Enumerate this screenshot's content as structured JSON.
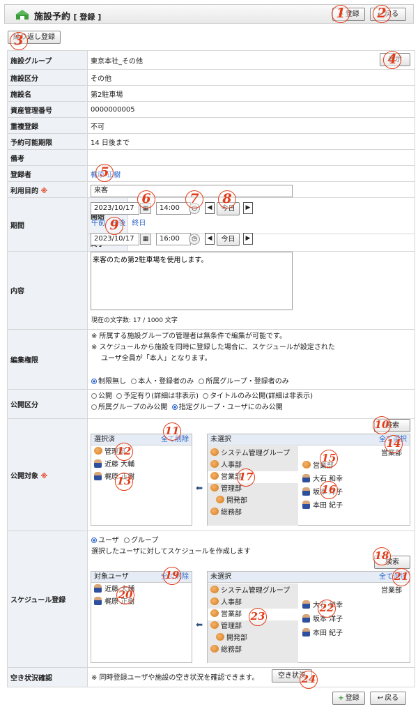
{
  "header": {
    "title": "施設予約",
    "mode": "[ 登録 ]",
    "register": "登録",
    "back": "戻る"
  },
  "repeat_button": "繰り返し登録",
  "facility": {
    "rows": [
      {
        "label": "施設グループ",
        "value": "東京本社_その他"
      },
      {
        "label": "施設区分",
        "value": "その他"
      },
      {
        "label": "施設名",
        "value": "第2駐車場"
      },
      {
        "label": "資産管理番号",
        "value": "0000000005"
      },
      {
        "label": "重複登録",
        "value": "不可"
      },
      {
        "label": "予約可能期限",
        "value": "14 日後まで"
      },
      {
        "label": "備考",
        "value": ""
      }
    ],
    "display_button": "表示"
  },
  "form": {
    "registrant_label": "登録者",
    "registrant": "梶原 正樹",
    "purpose_label": "利用目的",
    "required_mark": "※",
    "purpose": "来客",
    "period_label": "期間",
    "start_label": "開始",
    "end_label": "終了",
    "start_date": "2023/10/17",
    "start_time": "14:00",
    "end_date": "2023/10/17",
    "end_time": "16:00",
    "today": "今日",
    "am": "午前",
    "pm": "午後",
    "allday": "終日",
    "content_label": "内容",
    "content": "来客のため第2駐車場を使用します。",
    "char_count": "現在の文字数: 17 / 1000 文字",
    "edit_label": "編集権限",
    "edit_note1": "※ 所属する施設グループの管理者は無条件で編集が可能です。",
    "edit_note2": "※ スケジュールから施設を同時に登録した場合に、スケジュールが設定された",
    "edit_note3": "ユーザ全員が「本人」となります。",
    "edit_opts": [
      "制限無し",
      "本人・登録者のみ",
      "所属グループ・登録者のみ"
    ],
    "public_label": "公開区分",
    "public_opts": [
      "公開",
      "予定有り(詳細は非表示)",
      "タイトルのみ公開(詳細は非表示)",
      "所属グループのみ公開",
      "指定グループ・ユーザにのみ公開"
    ],
    "target_label": "公開対象",
    "search": "検索",
    "selected": "選択済",
    "clear_all": "全て削除",
    "unselected": "未選択",
    "select_all": "全て選択",
    "selected_items": [
      "管理部",
      "近藤 大輔",
      "梶原 正樹"
    ],
    "groups": [
      "システム管理グループ",
      "人事部",
      "営業部",
      "管理部",
      "開発部",
      "総務部"
    ],
    "dept": "営業部",
    "users": [
      "営業部",
      "大石 和幸",
      "坂本 洋子",
      "本田 紀子"
    ],
    "sched_label": "スケジュール登録",
    "sched_opts": [
      "ユーザ",
      "グループ"
    ],
    "sched_note": "選択したユーザに対してスケジュールを作成します",
    "target_users": "対象ユーザ",
    "sched_selected": [
      "近藤 大輔",
      "梶原 正樹"
    ],
    "sched_users": [
      "大石 和幸",
      "坂本 洋子",
      "本田 紀子"
    ],
    "vacancy_label": "空き状況確認",
    "vacancy_note": "※ 同時登録ユーザや施設の空き状況を確認できます。",
    "vacancy_button": "空き状況"
  },
  "markers": [
    "1",
    "2",
    "3",
    "4",
    "5",
    "6",
    "7",
    "8",
    "9",
    "10",
    "11",
    "12",
    "13",
    "14",
    "15",
    "16",
    "17",
    "18",
    "19",
    "20",
    "21",
    "22",
    "23",
    "24"
  ],
  "colors": {
    "marker": "#e23c1a",
    "link": "#2561c9",
    "label_bg": "#eef1f6"
  }
}
